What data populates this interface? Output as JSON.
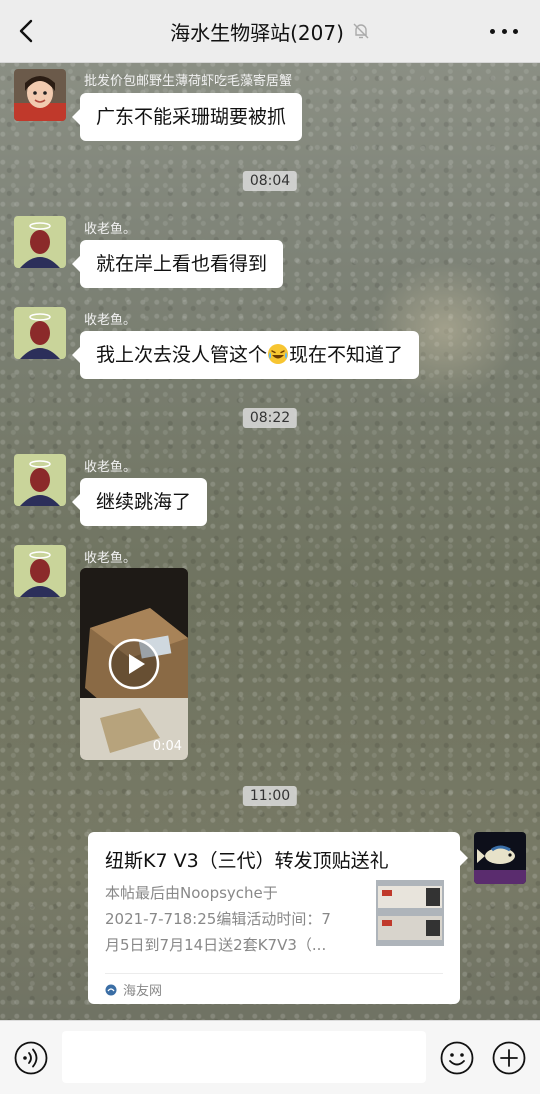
{
  "header": {
    "title": "海水生物驿站(207)",
    "back_icon": "chevron-left-icon",
    "mute_icon": "bell-off-icon",
    "more_icon": "more-dots-icon"
  },
  "messages": [
    {
      "sender": "批发价包邮野生薄荷虾吃毛藻寄居蟹",
      "text": "广东不能采珊瑚要被抓"
    },
    {
      "time": "08:04"
    },
    {
      "sender": "收老鱼。",
      "text": "就在岸上看也看得到"
    },
    {
      "sender": "收老鱼。",
      "text_before": "我上次去没人管这个",
      "text_after": "现在不知道了",
      "emoji": "crying-laughing-emoji"
    },
    {
      "time": "08:22"
    },
    {
      "sender": "收老鱼。",
      "text": "继续跳海了"
    },
    {
      "sender": "收老鱼。",
      "video_duration": "0:04",
      "play_icon": "play-icon"
    },
    {
      "time": "11:00"
    }
  ],
  "card": {
    "title": "纽斯K7 V3（三代）转发顶贴送礼",
    "desc_lines": [
      "本帖最后由Noopsyche于",
      "2021-7-718:25编辑活动时间：7",
      "月5日到7月14日送2套K7V3（..."
    ],
    "source": "海友网",
    "source_icon": "haiyou-logo-icon"
  },
  "input": {
    "placeholder": ""
  },
  "colors": {
    "header_bg": "#ededed",
    "bubble_bg": "#ffffff",
    "bottom_bg": "#f6f6f6"
  }
}
